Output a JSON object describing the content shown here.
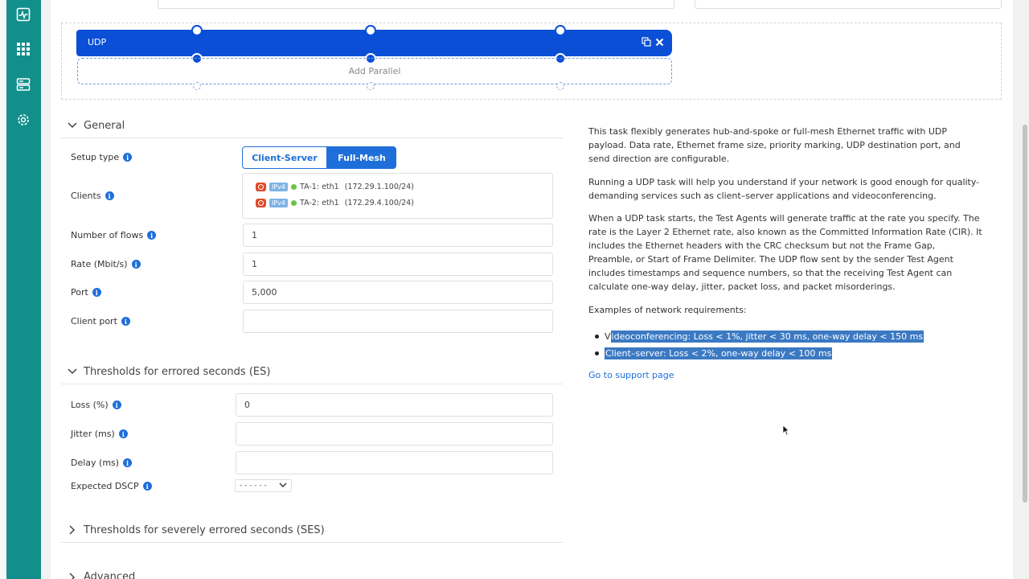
{
  "nav": {
    "items": [
      {
        "name": "monitoring-icon"
      },
      {
        "name": "apps-grid-icon"
      },
      {
        "name": "server-icon"
      },
      {
        "name": "settings-gear-icon"
      }
    ]
  },
  "canvas": {
    "task_label": "UDP",
    "add_parallel": "Add Parallel",
    "accent": "#0a4fd6"
  },
  "general": {
    "title": "General",
    "setup_type_label": "Setup type",
    "setup_options": [
      "Client-Server",
      "Full-Mesh"
    ],
    "setup_selected": "Full-Mesh",
    "clients_label": "Clients",
    "clients": [
      {
        "tag": "IPv4",
        "name": "TA-1: eth1",
        "ip": "(172.29.1.100/24)"
      },
      {
        "tag": "IPv4",
        "name": "TA-2: eth1",
        "ip": "(172.29.4.100/24)"
      }
    ],
    "flows_label": "Number of flows",
    "flows_value": "1",
    "rate_label": "Rate (Mbit/s)",
    "rate_value": "1",
    "port_label": "Port",
    "port_value": "5,000",
    "client_port_label": "Client port",
    "client_port_value": ""
  },
  "es": {
    "title": "Thresholds for errored seconds (ES)",
    "loss_label": "Loss (%)",
    "loss_value": "0",
    "jitter_label": "Jitter (ms)",
    "jitter_value": "",
    "delay_label": "Delay (ms)",
    "delay_value": "",
    "dscp_label": "Expected DSCP",
    "dscp_value": "- - - - - -"
  },
  "ses": {
    "title": "Thresholds for severely errored seconds (SES)"
  },
  "advanced": {
    "title": "Advanced"
  },
  "help": {
    "p1": "This task flexibly generates hub-and-spoke or full-mesh Ethernet traffic with UDP payload. Data rate, Ethernet frame size, priority marking, UDP destination port, and send direction are configurable.",
    "p2": "Running a UDP task will help you understand if your network is good enough for quality-demanding services such as client–server applications and videoconferencing.",
    "p3": "When a UDP task starts, the Test Agents will generate traffic at the rate you specify. The rate is the Layer 2 Ethernet rate, also known as the Committed Information Rate (CIR). It includes the Ethernet headers with the CRC checksum but not the Frame Gap, Preamble, or Start of Frame Delimiter. The UDP flow sent by the sender Test Agent includes timestamps and sequence numbers, so that the receiving Test Agent can calculate one-way delay, jitter, packet loss, and packet misorderings.",
    "examples_title": "Examples of network requirements:",
    "ex1_first": "V",
    "ex1_rest": "ideoconferencing: Loss < 1%, jitter < 30 ms, one-way delay < 150 ms",
    "ex2": "Client–server: Loss < 2%, one-way delay < 100 ms",
    "support_link": "Go to support page"
  }
}
